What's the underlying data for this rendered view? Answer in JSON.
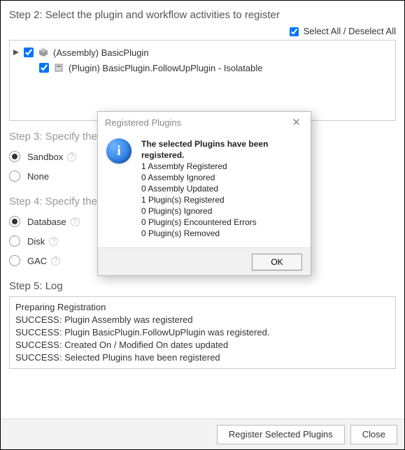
{
  "step2": {
    "header": "Step 2: Select the plugin and workflow activities to register",
    "selectAllLabel": "Select All / Deselect All",
    "tree": {
      "assembly": {
        "label": "(Assembly) BasicPlugin"
      },
      "plugin": {
        "label": "(Plugin) BasicPlugin.FollowUpPlugin - Isolatable"
      }
    }
  },
  "step3": {
    "header": "Step 3: Specify the",
    "options": {
      "sandbox": "Sandbox",
      "none": "None"
    }
  },
  "step4": {
    "header": "Step 4: Specify the",
    "options": {
      "database": "Database",
      "disk": "Disk",
      "gac": "GAC"
    }
  },
  "step5": {
    "header": "Step 5: Log",
    "lines": [
      "Preparing Registration",
      "SUCCESS: Plugin Assembly was registered",
      "SUCCESS: Plugin BasicPlugin.FollowUpPlugin was registered.",
      "SUCCESS: Created On / Modified On dates updated",
      "SUCCESS: Selected Plugins have been registered"
    ]
  },
  "footer": {
    "registerLabel": "Register Selected Plugins",
    "closeLabel": "Close"
  },
  "dialog": {
    "title": "Registered Plugins",
    "headline": "The selected Plugins have been registered.",
    "lines": [
      "1 Assembly Registered",
      "0 Assembly Ignored",
      "0 Assembly Updated",
      "1 Plugin(s) Registered",
      "0 Plugin(s) Ignored",
      "0 Plugin(s) Encountered Errors",
      "0 Plugin(s) Removed"
    ],
    "ok": "OK"
  }
}
